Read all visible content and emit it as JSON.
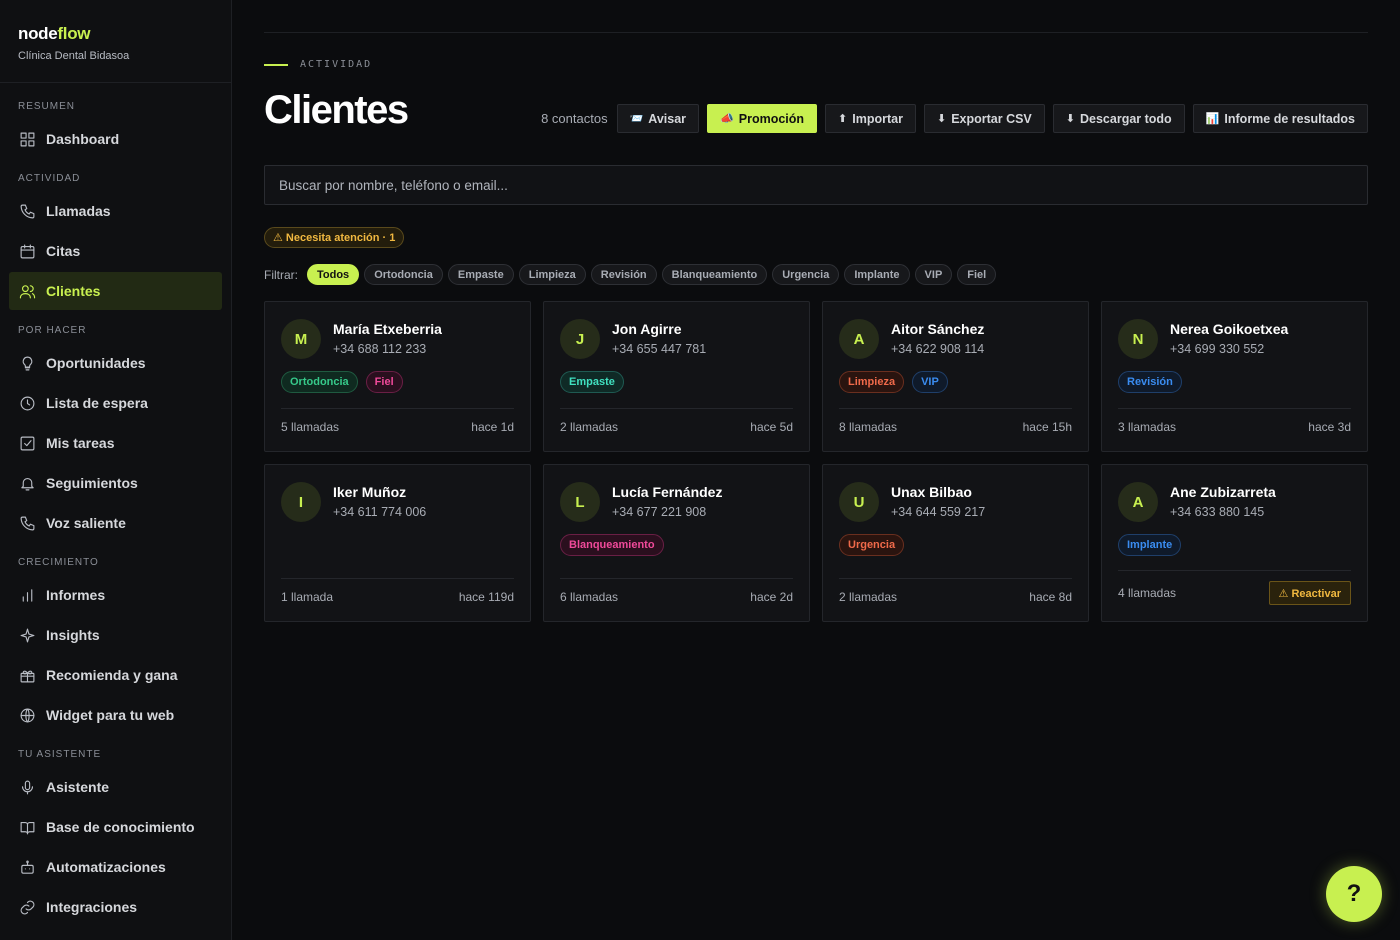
{
  "brand": {
    "name_prefix": "node",
    "name_accent": "flow",
    "subtitle": "Clínica Dental Bidasoa"
  },
  "sidebar": {
    "sections": [
      {
        "title": "RESUMEN",
        "items": [
          {
            "label": "Dashboard",
            "icon": "grid-icon"
          }
        ]
      },
      {
        "title": "ACTIVIDAD",
        "items": [
          {
            "label": "Llamadas",
            "icon": "phone-icon"
          },
          {
            "label": "Citas",
            "icon": "calendar-icon"
          },
          {
            "label": "Clientes",
            "icon": "users-icon",
            "active": true
          }
        ]
      },
      {
        "title": "POR HACER",
        "items": [
          {
            "label": "Oportunidades",
            "icon": "lightbulb-icon"
          },
          {
            "label": "Lista de espera",
            "icon": "clock-icon"
          },
          {
            "label": "Mis tareas",
            "icon": "checkbox-icon"
          },
          {
            "label": "Seguimientos",
            "icon": "bell-icon"
          },
          {
            "label": "Voz saliente",
            "icon": "phone-icon"
          }
        ]
      },
      {
        "title": "CRECIMIENTO",
        "items": [
          {
            "label": "Informes",
            "icon": "bar-chart-icon"
          },
          {
            "label": "Insights",
            "icon": "sparkle-icon"
          },
          {
            "label": "Recomienda y gana",
            "icon": "gift-icon"
          },
          {
            "label": "Widget para tu web",
            "icon": "globe-icon"
          }
        ]
      },
      {
        "title": "TU ASISTENTE",
        "items": [
          {
            "label": "Asistente",
            "icon": "mic-icon"
          },
          {
            "label": "Base de conocimiento",
            "icon": "book-icon"
          },
          {
            "label": "Automatizaciones",
            "icon": "robot-icon"
          },
          {
            "label": "Integraciones",
            "icon": "link-icon"
          }
        ]
      }
    ]
  },
  "page": {
    "eyebrow": "ACTIVIDAD",
    "title": "Clientes"
  },
  "toolbar": {
    "count": "8 contactos",
    "buttons": [
      {
        "label": "Avisar",
        "glyph": "📨",
        "icon": "envelope-icon"
      },
      {
        "label": "Promoción",
        "glyph": "📣",
        "icon": "megaphone-icon",
        "primary": true
      },
      {
        "label": "Importar",
        "glyph": "⬆",
        "icon": "upload-icon"
      },
      {
        "label": "Exportar CSV",
        "glyph": "⬇",
        "icon": "download-icon"
      },
      {
        "label": "Descargar todo",
        "glyph": "⬇",
        "icon": "download-icon"
      },
      {
        "label": "Informe de resultados",
        "glyph": "📊",
        "icon": "chart-icon"
      }
    ]
  },
  "search": {
    "placeholder": "Buscar por nombre, teléfono o email..."
  },
  "attention": {
    "label": "⚠ Necesita atención · 1"
  },
  "filters": {
    "label": "Filtrar:",
    "options": [
      "Todos",
      "Ortodoncia",
      "Empaste",
      "Limpieza",
      "Revisión",
      "Blanqueamiento",
      "Urgencia",
      "Implante",
      "VIP",
      "Fiel"
    ],
    "selected": "Todos"
  },
  "tag_colors": {
    "Ortodoncia": {
      "fg": "#36c98a",
      "bg": "#0f2a20",
      "border": "#1f5a40"
    },
    "Fiel": {
      "fg": "#f04a9a",
      "bg": "#2a0f1e",
      "border": "#6a1f45"
    },
    "Empaste": {
      "fg": "#40e0c0",
      "bg": "#0f2a26",
      "border": "#1f5a52"
    },
    "Limpieza": {
      "fg": "#f06a4a",
      "bg": "#2a140f",
      "border": "#6a2f1f"
    },
    "VIP": {
      "fg": "#3a8cf0",
      "bg": "#0f1a2a",
      "border": "#1f3f6a"
    },
    "Revisión": {
      "fg": "#3a8cf0",
      "bg": "#0f1a2a",
      "border": "#1f3f6a"
    },
    "Blanqueamiento": {
      "fg": "#f04a9a",
      "bg": "#2a0f1e",
      "border": "#6a1f45"
    },
    "Urgencia": {
      "fg": "#f06a4a",
      "bg": "#2a140f",
      "border": "#6a2f1f"
    },
    "Implante": {
      "fg": "#3a8cf0",
      "bg": "#0f1a2a",
      "border": "#1f3f6a"
    }
  },
  "clients": [
    {
      "initial": "M",
      "name": "María Etxeberria",
      "phone": "+34 688 112 233",
      "tags": [
        "Ortodoncia",
        "Fiel"
      ],
      "calls": "5 llamadas",
      "last": "hace 1d"
    },
    {
      "initial": "J",
      "name": "Jon Agirre",
      "phone": "+34 655 447 781",
      "tags": [
        "Empaste"
      ],
      "calls": "2 llamadas",
      "last": "hace 5d"
    },
    {
      "initial": "A",
      "name": "Aitor Sánchez",
      "phone": "+34 622 908 114",
      "tags": [
        "Limpieza",
        "VIP"
      ],
      "calls": "8 llamadas",
      "last": "hace 15h"
    },
    {
      "initial": "N",
      "name": "Nerea Goikoetxea",
      "phone": "+34 699 330 552",
      "tags": [
        "Revisión"
      ],
      "calls": "3 llamadas",
      "last": "hace 3d"
    },
    {
      "initial": "I",
      "name": "Iker Muñoz",
      "phone": "+34 611 774 006",
      "tags": [],
      "calls": "1 llamada",
      "last": "hace 119d"
    },
    {
      "initial": "L",
      "name": "Lucía Fernández",
      "phone": "+34 677 221 908",
      "tags": [
        "Blanqueamiento"
      ],
      "calls": "6 llamadas",
      "last": "hace 2d"
    },
    {
      "initial": "U",
      "name": "Unax Bilbao",
      "phone": "+34 644 559 217",
      "tags": [
        "Urgencia"
      ],
      "calls": "2 llamadas",
      "last": "hace 8d"
    },
    {
      "initial": "A",
      "name": "Ane Zubizarreta",
      "phone": "+34 633 880 145",
      "tags": [
        "Implante"
      ],
      "calls": "4 llamadas",
      "action": "⚠ Reactivar"
    }
  ],
  "help": {
    "label": "?"
  }
}
